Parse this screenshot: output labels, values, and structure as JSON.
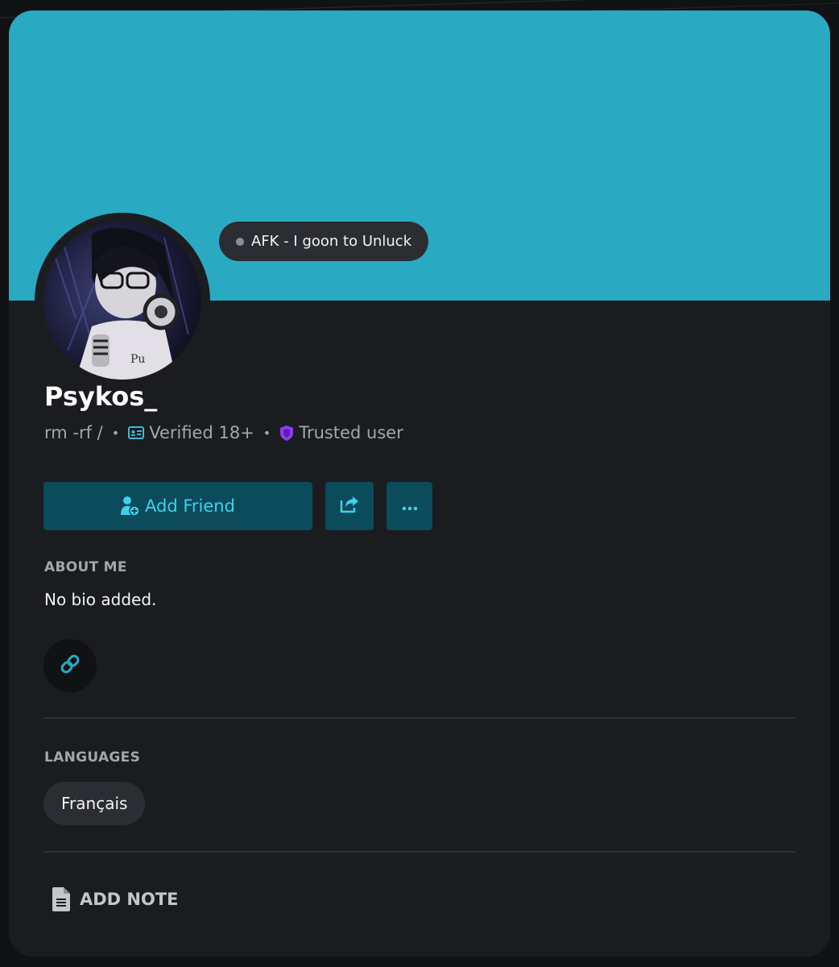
{
  "profile": {
    "status_text": "AFK - I goon to Unluck",
    "username": "Psykos_",
    "tagline": "rm -rf /",
    "badge_verified": "Verified 18+",
    "badge_trusted": "Trusted user",
    "separator": "•"
  },
  "actions": {
    "add_friend_label": "Add Friend"
  },
  "about": {
    "heading": "ABOUT ME",
    "bio": "No bio added."
  },
  "languages": {
    "heading": "LANGUAGES",
    "items": [
      "Français"
    ]
  },
  "note": {
    "label": "ADD NOTE"
  },
  "colors": {
    "banner": "#2aa9c2",
    "accent": "#3fd0ec",
    "button_bg": "#0b4b5b",
    "card_bg": "#1a1c20",
    "trusted_shield": "#8b3cf0"
  },
  "icons": {
    "status": "status-dot-icon",
    "verified": "id-card-icon",
    "trusted": "shield-icon",
    "add_friend": "user-plus-icon",
    "share": "share-icon",
    "more": "ellipsis-icon",
    "link": "link-icon",
    "note": "document-icon"
  }
}
